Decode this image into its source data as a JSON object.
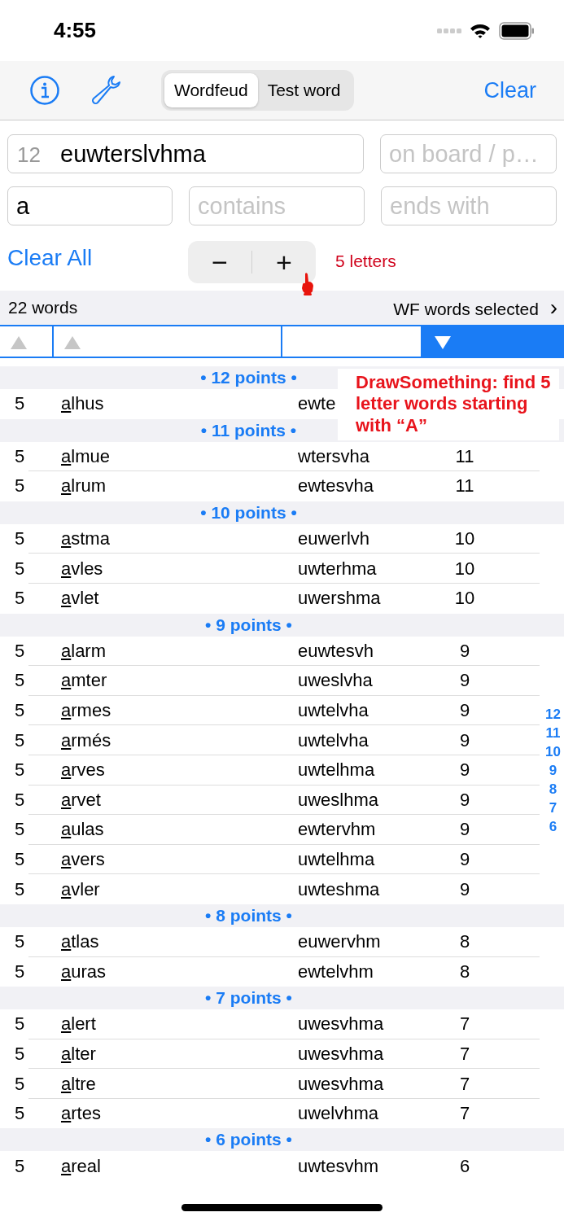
{
  "status_bar": {
    "time": "4:55"
  },
  "toolbar": {
    "tabs": [
      {
        "label": "Wordfeud",
        "selected": true
      },
      {
        "label": "Test word",
        "selected": false
      }
    ],
    "clear": "Clear"
  },
  "fields": {
    "letters": {
      "count": "12",
      "value": "euwterslvhma"
    },
    "on_board": {
      "placeholder": "on board / p…"
    },
    "starts_with": {
      "value": "a"
    },
    "contains": {
      "placeholder": "contains"
    },
    "ends_with": {
      "placeholder": "ends with"
    }
  },
  "controls": {
    "clear_all": "Clear All",
    "minus": "−",
    "plus": "+",
    "length_label": "5 letters"
  },
  "summary": {
    "count": "22 words",
    "filter": "WF words selected",
    "chevron": "›"
  },
  "sort_columns": [
    {
      "kind": "ascending",
      "selected": false
    },
    {
      "kind": "ascending",
      "selected": false
    },
    {
      "kind": "none",
      "selected": false
    },
    {
      "kind": "descending",
      "selected": true
    }
  ],
  "groups": [
    {
      "header": "• 12 points •",
      "rows": [
        {
          "length": "5",
          "word": "alhus",
          "letters": "ewte"
        }
      ]
    },
    {
      "header": "• 11 points •",
      "rows": [
        {
          "length": "5",
          "word": "almue",
          "letters": "wtersvha",
          "points": "11"
        },
        {
          "length": "5",
          "word": "alrum",
          "letters": "ewtesvha",
          "points": "11"
        }
      ]
    },
    {
      "header": "• 10 points •",
      "rows": [
        {
          "length": "5",
          "word": "astma",
          "letters": "euwerlvh",
          "points": "10"
        },
        {
          "length": "5",
          "word": "avles",
          "letters": "uwterhma",
          "points": "10"
        },
        {
          "length": "5",
          "word": "avlet",
          "letters": "uwershma",
          "points": "10"
        }
      ]
    },
    {
      "header": "• 9 points •",
      "rows": [
        {
          "length": "5",
          "word": "alarm",
          "letters": "euwtesvh",
          "points": "9"
        },
        {
          "length": "5",
          "word": "amter",
          "letters": "uweslvha",
          "points": "9"
        },
        {
          "length": "5",
          "word": "armes",
          "letters": "uwtelvha",
          "points": "9"
        },
        {
          "length": "5",
          "word": "armés",
          "letters": "uwtelvha",
          "points": "9"
        },
        {
          "length": "5",
          "word": "arves",
          "letters": "uwtelhma",
          "points": "9"
        },
        {
          "length": "5",
          "word": "arvet",
          "letters": "uweslhma",
          "points": "9"
        },
        {
          "length": "5",
          "word": "aulas",
          "letters": "ewtervhm",
          "points": "9"
        },
        {
          "length": "5",
          "word": "avers",
          "letters": "uwtelhma",
          "points": "9"
        },
        {
          "length": "5",
          "word": "avler",
          "letters": "uwteshma",
          "points": "9"
        }
      ]
    },
    {
      "header": "• 8 points •",
      "rows": [
        {
          "length": "5",
          "word": "atlas",
          "letters": "euwervhm",
          "points": "8"
        },
        {
          "length": "5",
          "word": "auras",
          "letters": "ewtelvhm",
          "points": "8"
        }
      ]
    },
    {
      "header": "• 7 points •",
      "rows": [
        {
          "length": "5",
          "word": "alert",
          "letters": "uwesvhma",
          "points": "7"
        },
        {
          "length": "5",
          "word": "alter",
          "letters": "uwesvhma",
          "points": "7"
        },
        {
          "length": "5",
          "word": "altre",
          "letters": "uwesvhma",
          "points": "7"
        },
        {
          "length": "5",
          "word": "artes",
          "letters": "uwelvhma",
          "points": "7"
        }
      ]
    },
    {
      "header": "• 6 points •",
      "rows": [
        {
          "length": "5",
          "word": "areal",
          "letters": "uwtesvhm",
          "points": "6"
        }
      ]
    }
  ],
  "section_index": [
    "12",
    "11",
    "10",
    "9",
    "8",
    "7",
    "6"
  ],
  "note": {
    "text": "DrawSomething: find 5 letter words starting with “A”"
  }
}
